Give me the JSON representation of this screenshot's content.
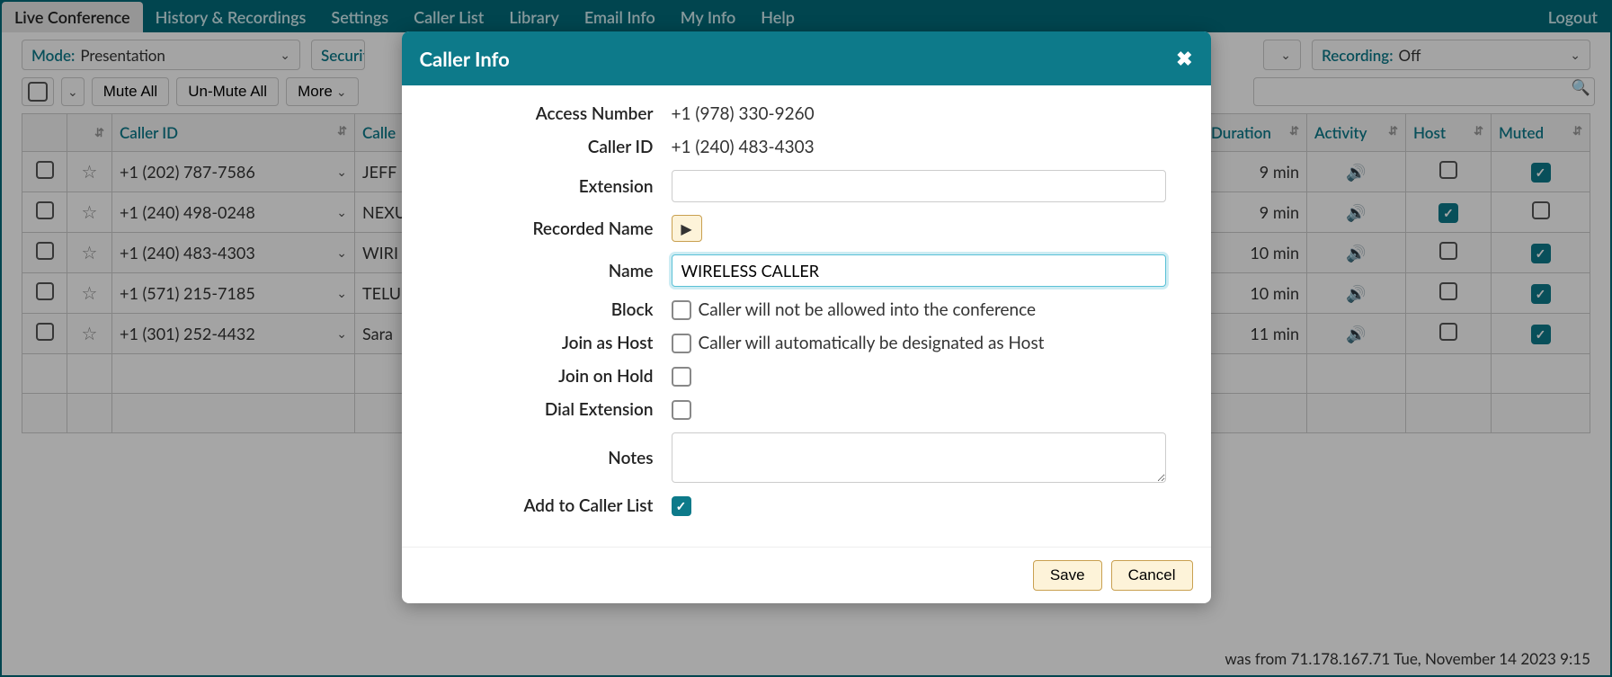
{
  "nav": {
    "tabs": [
      "Live Conference",
      "History & Recordings",
      "Settings",
      "Caller List",
      "Library",
      "Email Info",
      "My Info",
      "Help"
    ],
    "active": 0,
    "logout": "Logout"
  },
  "toolbar": {
    "mode_label": "Mode:",
    "mode_value": "Presentation",
    "security_label": "Securit",
    "recording_label": "Recording:",
    "recording_value": "Off"
  },
  "controls": {
    "mute_all": "Mute All",
    "unmute_all": "Un-Mute All",
    "more": "More"
  },
  "columns": {
    "caller_id": "Caller ID",
    "caller_name": "Calle",
    "duration": "Duration",
    "activity": "Activity",
    "host": "Host",
    "muted": "Muted"
  },
  "rows": [
    {
      "caller_id": "+1 (202) 787-7586",
      "name": "JEFF",
      "duration": "9 min",
      "host": false,
      "muted": true
    },
    {
      "caller_id": "+1 (240) 498-0248",
      "name": "NEXU",
      "duration": "9 min",
      "host": true,
      "muted": false
    },
    {
      "caller_id": "+1 (240) 483-4303",
      "name": "WIRI",
      "duration": "10 min",
      "host": false,
      "muted": true
    },
    {
      "caller_id": "+1 (571) 215-7185",
      "name": "TELU",
      "duration": "10 min",
      "host": false,
      "muted": true
    },
    {
      "caller_id": "+1 (301) 252-4432",
      "name": "Sara",
      "duration": "11 min",
      "host": false,
      "muted": true
    }
  ],
  "footer": "was from 71.178.167.71 Tue, November 14 2023 9:15",
  "modal": {
    "title": "Caller Info",
    "labels": {
      "access_number": "Access Number",
      "caller_id": "Caller ID",
      "extension": "Extension",
      "recorded_name": "Recorded Name",
      "name": "Name",
      "block": "Block",
      "join_host": "Join as Host",
      "join_hold": "Join on Hold",
      "dial_ext": "Dial Extension",
      "notes": "Notes",
      "add_list": "Add to Caller List"
    },
    "values": {
      "access_number": "+1 (978) 330-9260",
      "caller_id": "+1 (240) 483-4303",
      "extension": "",
      "name": "WIRELESS CALLER",
      "block_text": "Caller will not be allowed into the conference",
      "host_text": "Caller will automatically be designated as Host",
      "notes": "",
      "block": false,
      "join_host": false,
      "join_hold": false,
      "dial_ext": false,
      "add_list": true
    },
    "buttons": {
      "save": "Save",
      "cancel": "Cancel"
    }
  }
}
